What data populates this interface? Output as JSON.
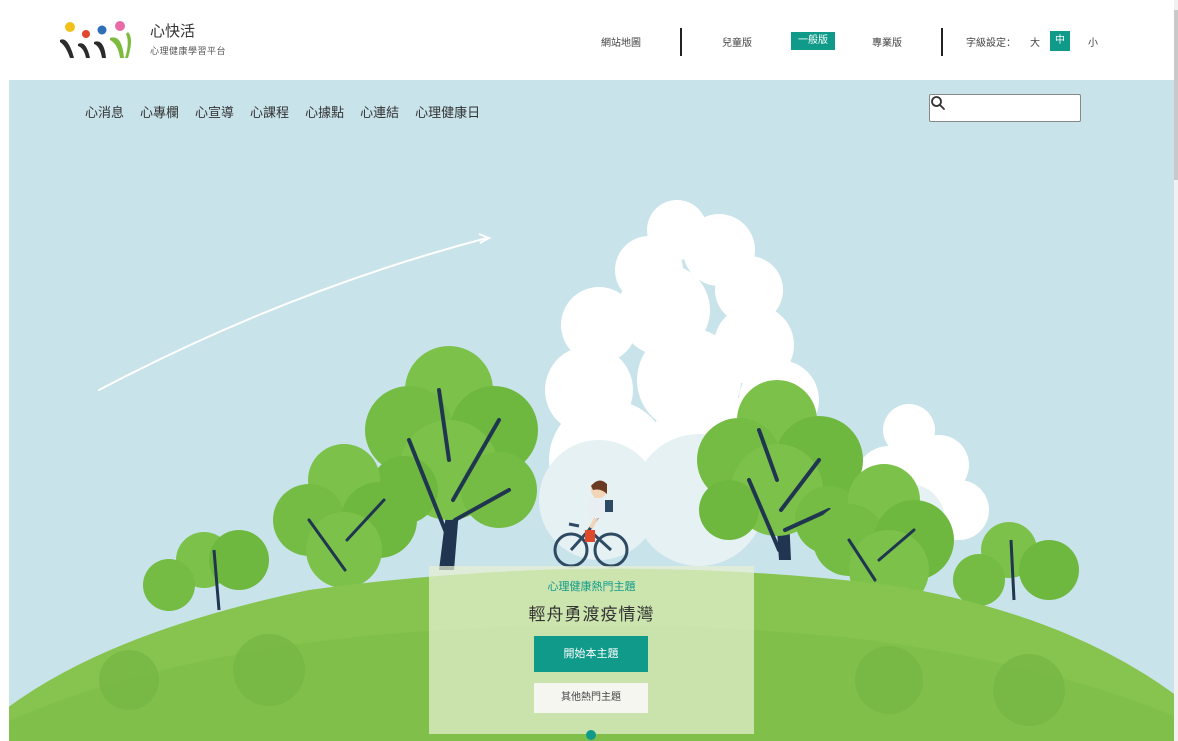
{
  "brand": {
    "title": "心快活",
    "subtitle": "心理健康學習平台"
  },
  "utility": {
    "sitemap": "網站地圖",
    "versions": {
      "kids": "兒童版",
      "general": "一般版",
      "pro": "專業版"
    },
    "font_size": {
      "label": "字級設定：",
      "large": "大",
      "medium": "中",
      "small": "小"
    }
  },
  "nav": [
    "心消息",
    "心專欄",
    "心宣導",
    "心課程",
    "心據點",
    "心連結",
    "心理健康日"
  ],
  "search": {
    "value": ""
  },
  "feature": {
    "category": "心理健康熱門主題",
    "title": "輕舟勇渡疫情灣",
    "start_button": "開始本主題",
    "other_button": "其他熱門主題"
  },
  "colors": {
    "accent": "#0f9a8a",
    "sky": "#c8e3ea",
    "grass": "#7fbf4a"
  }
}
